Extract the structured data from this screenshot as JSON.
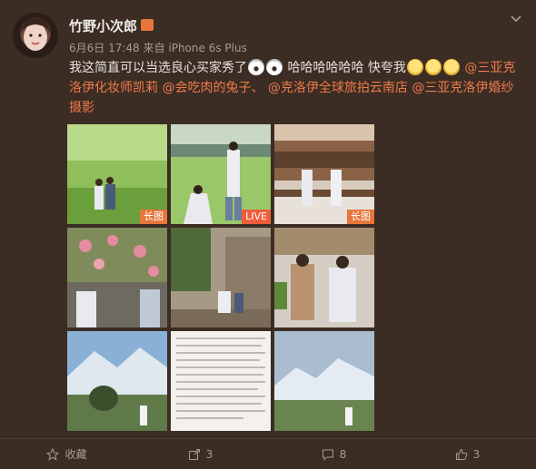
{
  "user": {
    "name": "竹野小次郎",
    "date": "6月6日",
    "time": "17:48",
    "via_prefix": "来自",
    "device": "iPhone 6s Plus"
  },
  "post": {
    "text_1": "我这简直可以当选良心买家秀了",
    "text_2": "哈哈哈哈哈哈 快夸我",
    "mention_1": "@三亚克洛伊化妆师凯莉",
    "mention_2": "@会吃肉的兔子、",
    "mention_3": "@克洛伊全球旅拍云南店",
    "mention_4": "@三亚克洛伊婚纱摄影"
  },
  "images": [
    {
      "badge": "长图"
    },
    {
      "badge": "LIVE"
    },
    {
      "badge": "长图"
    },
    {
      "badge": ""
    },
    {
      "badge": ""
    },
    {
      "badge": ""
    },
    {
      "badge": ""
    },
    {
      "badge": ""
    },
    {
      "badge": ""
    }
  ],
  "footer": {
    "favorite_label": "收藏",
    "repost_count": "3",
    "comment_count": "8",
    "like_count": "3"
  },
  "colors": {
    "background": "#3b2c24",
    "mention": "#f07b4a",
    "badge": "#e8763a"
  },
  "icons": [
    "star-icon",
    "repost-icon",
    "comment-icon",
    "like-icon",
    "chevron-down-icon"
  ]
}
